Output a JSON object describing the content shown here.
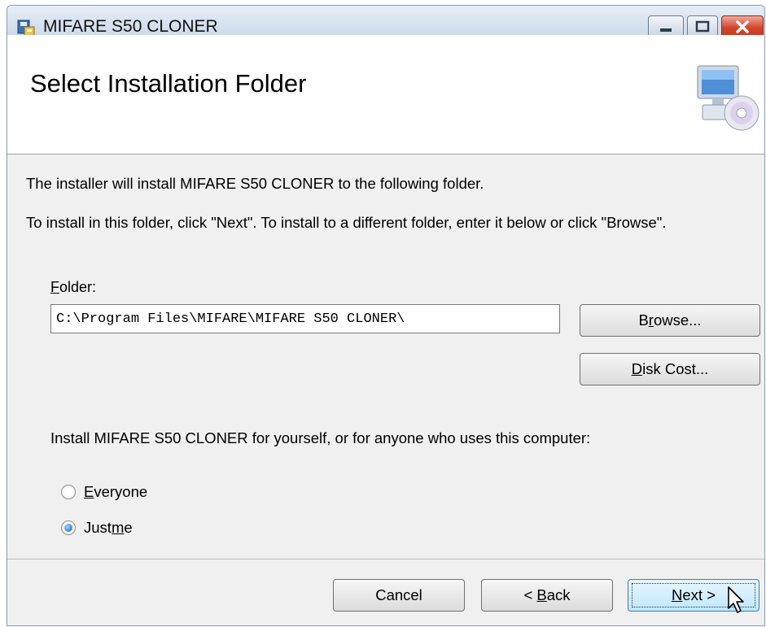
{
  "window": {
    "title": "MIFARE S50 CLONER"
  },
  "banner": {
    "title": "Select Installation Folder",
    "icon": "computer-cd-icon"
  },
  "intro": {
    "line1": "The installer will install MIFARE S50 CLONER to the following folder.",
    "line2": "To install in this folder, click \"Next\". To install to a different folder, enter it below or click \"Browse\"."
  },
  "folder": {
    "label_access": "F",
    "label_rest": "older:",
    "value": "C:\\Program Files\\MIFARE\\MIFARE S50 CLONER\\"
  },
  "buttons": {
    "browse_pre": "B",
    "browse_access": "r",
    "browse_post": "owse...",
    "diskcost_access": "D",
    "diskcost_post": "isk Cost...",
    "cancel": "Cancel",
    "back_pre": "< ",
    "back_access": "B",
    "back_post": "ack",
    "next_access": "N",
    "next_post": "ext >"
  },
  "install_for": {
    "prompt": "Install MIFARE S50 CLONER for yourself, or for anyone who uses this computer:",
    "options": [
      {
        "access": "E",
        "rest": "veryone",
        "selected": false
      },
      {
        "pre": "Just ",
        "access": "m",
        "rest": "e",
        "selected": true
      }
    ]
  },
  "colors": {
    "close_button": "#c23b22",
    "titlebar": "#cfdceb",
    "next_button_border": "#3c7fb1"
  }
}
